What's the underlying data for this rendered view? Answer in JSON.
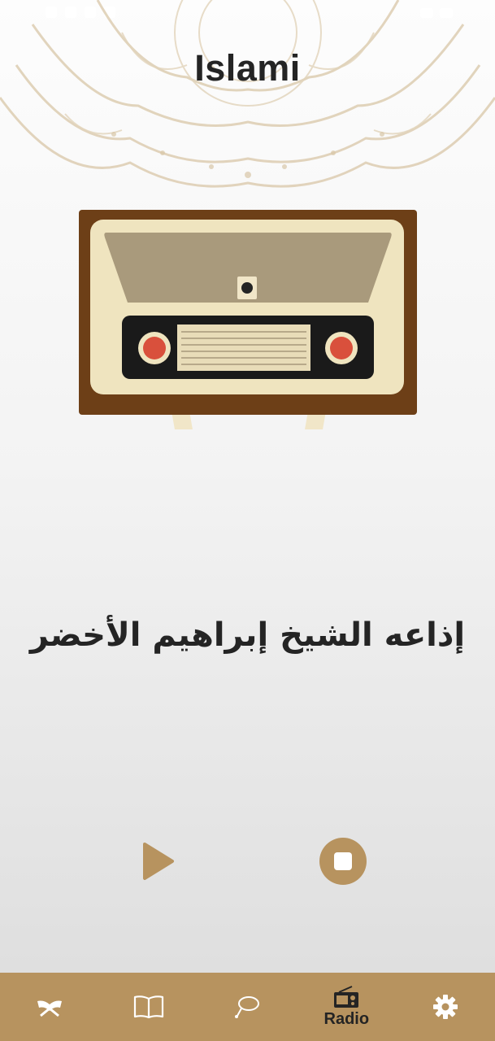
{
  "app": {
    "title": "Islami"
  },
  "radio": {
    "station_name": "إذاعه الشيخ إبراهيم الأخضر"
  },
  "controls": {
    "play_icon": "play-icon",
    "stop_icon": "stop-icon"
  },
  "bottom_nav": {
    "items": [
      {
        "icon": "quran-icon",
        "label": ""
      },
      {
        "icon": "book-icon",
        "label": ""
      },
      {
        "icon": "sebha-icon",
        "label": ""
      },
      {
        "icon": "radio-icon",
        "label": "Radio",
        "active": true
      },
      {
        "icon": "gear-icon",
        "label": ""
      }
    ]
  },
  "colors": {
    "accent": "#b7935f",
    "text": "#242424",
    "wood": "#6d3f17",
    "radio_face": "#efe4bf"
  }
}
